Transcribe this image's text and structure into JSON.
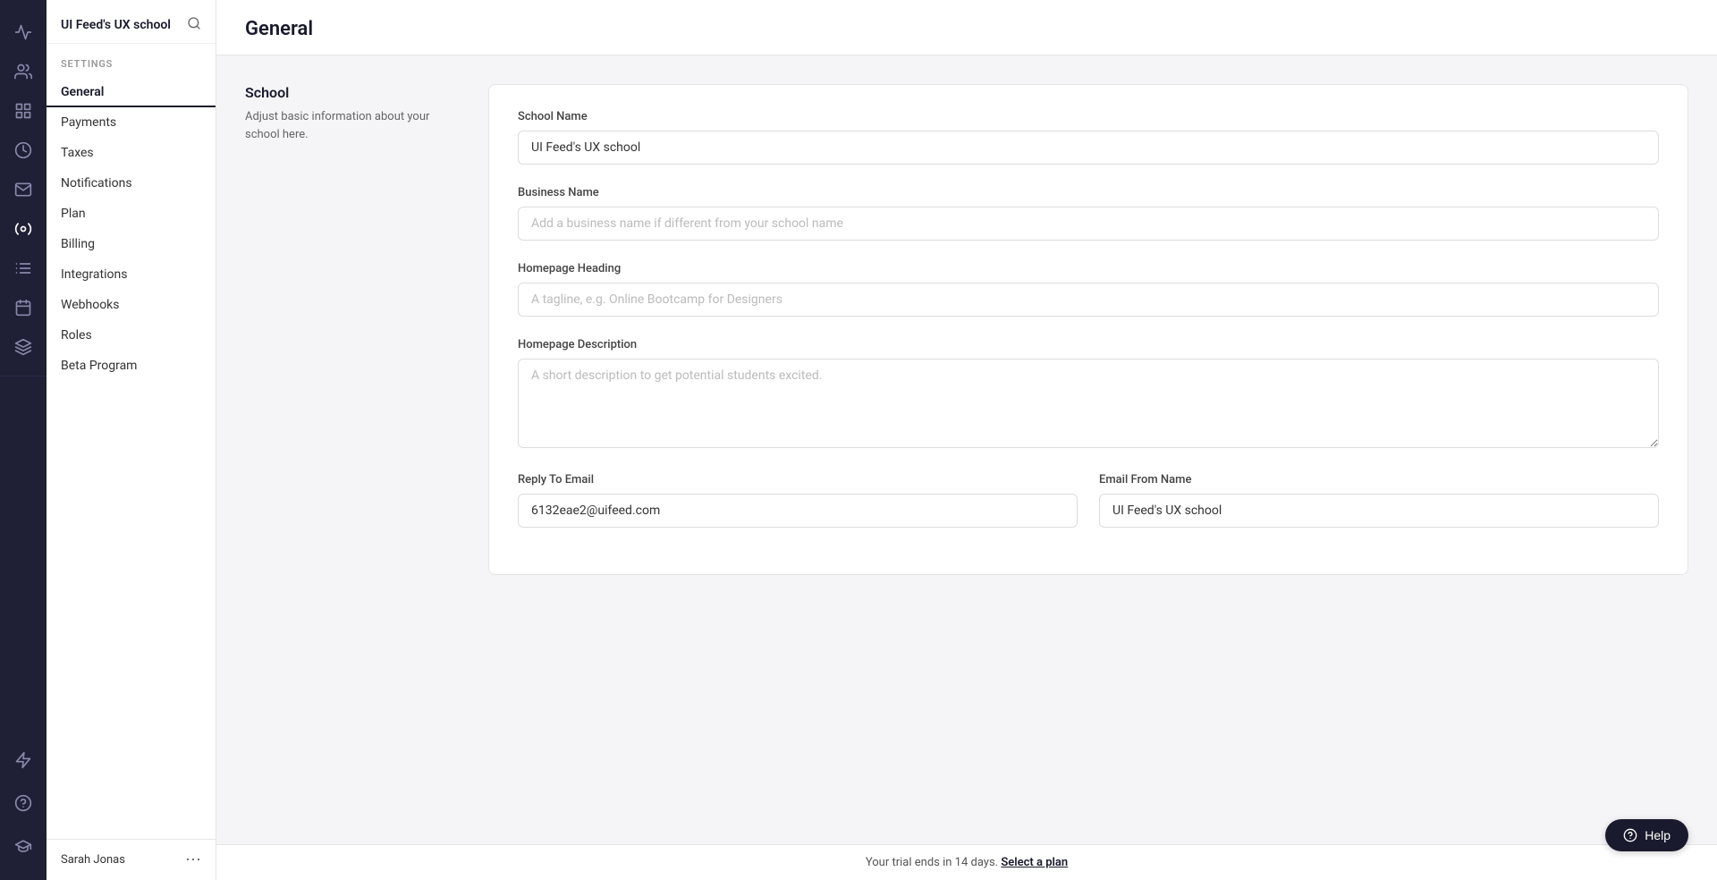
{
  "app": {
    "title": "UI Feed's UX school"
  },
  "header": {
    "page_title": "General"
  },
  "sidebar": {
    "settings_label": "SETTINGS",
    "nav_items": [
      {
        "label": "General",
        "active": true
      },
      {
        "label": "Payments",
        "active": false
      },
      {
        "label": "Taxes",
        "active": false
      },
      {
        "label": "Notifications",
        "active": false
      },
      {
        "label": "Plan",
        "active": false
      },
      {
        "label": "Billing",
        "active": false
      },
      {
        "label": "Integrations",
        "active": false
      },
      {
        "label": "Webhooks",
        "active": false
      },
      {
        "label": "Roles",
        "active": false
      },
      {
        "label": "Beta Program",
        "active": false
      }
    ],
    "user_name": "Sarah Jonas"
  },
  "section": {
    "title": "School",
    "description": "Adjust basic information about your school here."
  },
  "form": {
    "school_name_label": "School Name",
    "school_name_value": "UI Feed's UX school",
    "business_name_label": "Business Name",
    "business_name_placeholder": "Add a business name if different from your school name",
    "homepage_heading_label": "Homepage Heading",
    "homepage_heading_placeholder": "A tagline, e.g. Online Bootcamp for Designers",
    "homepage_description_label": "Homepage Description",
    "homepage_description_placeholder": "A short description to get potential students excited.",
    "reply_email_label": "Reply To Email",
    "reply_email_value": "6132eae2@uifeed.com",
    "email_from_label": "Email From Name",
    "email_from_value": "UI Feed's UX school"
  },
  "trial": {
    "message": "Your trial ends in 14 days.",
    "link_text": "Select a plan"
  },
  "help": {
    "label": "Help"
  },
  "icons": {
    "analytics": "📊",
    "users": "👥",
    "dashboard": "▦",
    "revenue": "💰",
    "mail": "✉",
    "settings": "⚙",
    "library": "📚",
    "calendar": "📅",
    "tools": "🔧",
    "lightning": "⚡",
    "question": "?",
    "graduation": "🎓",
    "search": "🔍",
    "more": "⋯"
  }
}
